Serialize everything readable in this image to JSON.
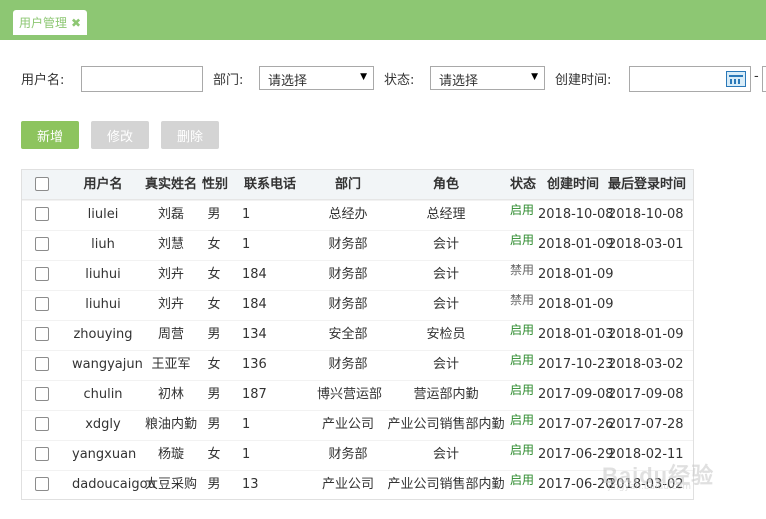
{
  "tab": {
    "title": "用户管理",
    "close": "✖"
  },
  "filters": {
    "username_label": "用户名:",
    "dept_label": "部门:",
    "dept_value": "请选择",
    "status_label": "状态:",
    "status_value": "请选择",
    "created_label": "创建时间:",
    "range_sep": "-"
  },
  "buttons": {
    "add": "新增",
    "edit": "修改",
    "delete": "删除"
  },
  "table": {
    "headers": [
      "用户名",
      "真实姓名",
      "性别",
      "联系电话",
      "部门",
      "角色",
      "状态",
      "创建时间",
      "最后登录时间"
    ],
    "rows": [
      {
        "username": "liulei",
        "name": "刘磊",
        "gender": "男",
        "phone": "1",
        "dept": "总经办",
        "role": "总经理",
        "status": "启用",
        "created": "2018-10-08",
        "last": "2018-10-08"
      },
      {
        "username": "liuh",
        "name": "刘慧",
        "gender": "女",
        "phone": "1",
        "dept": "财务部",
        "role": "会计",
        "status": "启用",
        "created": "2018-01-09",
        "last": "2018-03-01"
      },
      {
        "username": "liuhui",
        "name": "刘卉",
        "gender": "女",
        "phone": "184",
        "dept": "财务部",
        "role": "会计",
        "status": "禁用",
        "created": "2018-01-09",
        "last": ""
      },
      {
        "username": "liuhui",
        "name": "刘卉",
        "gender": "女",
        "phone": "184",
        "dept": "财务部",
        "role": "会计",
        "status": "禁用",
        "created": "2018-01-09",
        "last": ""
      },
      {
        "username": "zhouying",
        "name": "周营",
        "gender": "男",
        "phone": "134",
        "dept": "安全部",
        "role": "安检员",
        "status": "启用",
        "created": "2018-01-03",
        "last": "2018-01-09"
      },
      {
        "username": "wangyajun",
        "name": "王亚军",
        "gender": "女",
        "phone": "136",
        "dept": "财务部",
        "role": "会计",
        "status": "启用",
        "created": "2017-10-23",
        "last": "2018-03-02"
      },
      {
        "username": "chulin",
        "name": "初林",
        "gender": "男",
        "phone": "187",
        "dept": "博兴营运部",
        "role": "营运部内勤",
        "status": "启用",
        "created": "2017-09-08",
        "last": "2017-09-08"
      },
      {
        "username": "xdgly",
        "name": "粮油内勤",
        "gender": "男",
        "phone": "1",
        "dept": "产业公司",
        "role": "产业公司销售部内勤",
        "status": "启用",
        "created": "2017-07-26",
        "last": "2017-07-28"
      },
      {
        "username": "yangxuan",
        "name": "杨璇",
        "gender": "女",
        "phone": "1",
        "dept": "财务部",
        "role": "会计",
        "status": "启用",
        "created": "2017-06-29",
        "last": "2018-02-11"
      },
      {
        "username": "dadoucaigou",
        "name": "大豆采购",
        "gender": "男",
        "phone": "13",
        "dept": "产业公司",
        "role": "产业公司销售部内勤",
        "status": "启用",
        "created": "2017-06-20",
        "last": "2018-03-02"
      }
    ]
  },
  "watermark": {
    "brand": "Baidu经验",
    "sub": "jingyan.baidu.com"
  },
  "colors": {
    "accent": "#8dc773",
    "enabled": "#2e8b2e",
    "disabled": "#666666"
  }
}
